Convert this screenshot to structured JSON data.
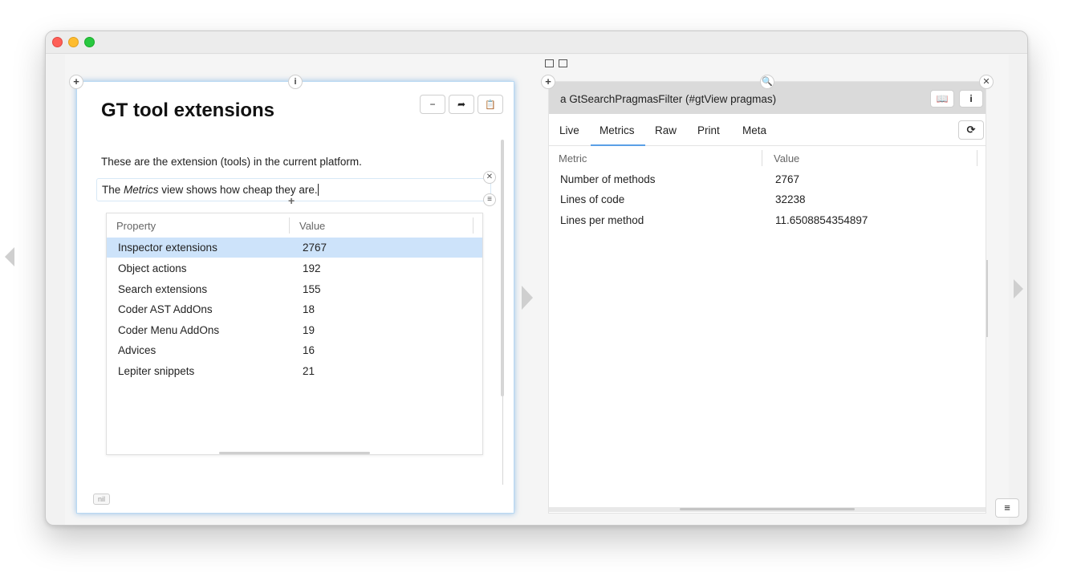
{
  "left_pane": {
    "title": "GT tool extensions",
    "toolbar": {
      "minimize_icon": "−",
      "share_icon": "➦",
      "clipboard_icon": "📋"
    },
    "paragraph1": "These are the extension (tools) in the current platform.",
    "snippet": {
      "before": "The ",
      "emphasis": "Metrics",
      "after": " view shows how cheap they are."
    },
    "table": {
      "headers": [
        "Property",
        "Value"
      ],
      "rows": [
        {
          "property": "Inspector extensions",
          "value": "2767",
          "selected": true
        },
        {
          "property": "Object actions",
          "value": "192"
        },
        {
          "property": "Search extensions",
          "value": "155"
        },
        {
          "property": "Coder AST AddOns",
          "value": "18"
        },
        {
          "property": "Coder Menu AddOns",
          "value": "19"
        },
        {
          "property": "Advices",
          "value": "16"
        },
        {
          "property": "Lepiter snippets",
          "value": "21"
        }
      ]
    },
    "nil_label": "nil"
  },
  "right_pane": {
    "title": "a GtSearchPragmasFilter (#gtView pragmas)",
    "tabs": [
      "Live",
      "Metrics",
      "Raw",
      "Print",
      "Meta"
    ],
    "active_tab": "Metrics",
    "table": {
      "headers": [
        "Metric",
        "Value"
      ],
      "rows": [
        {
          "metric": "Number of methods",
          "value": "2767"
        },
        {
          "metric": "Lines of code",
          "value": "32238"
        },
        {
          "metric": "Lines per method",
          "value": "11.6508854354897"
        }
      ]
    }
  },
  "colors": {
    "selection": "#cde3fa",
    "tab_accent": "#5aa0e6",
    "focus_glow": "#b9d9f3"
  }
}
